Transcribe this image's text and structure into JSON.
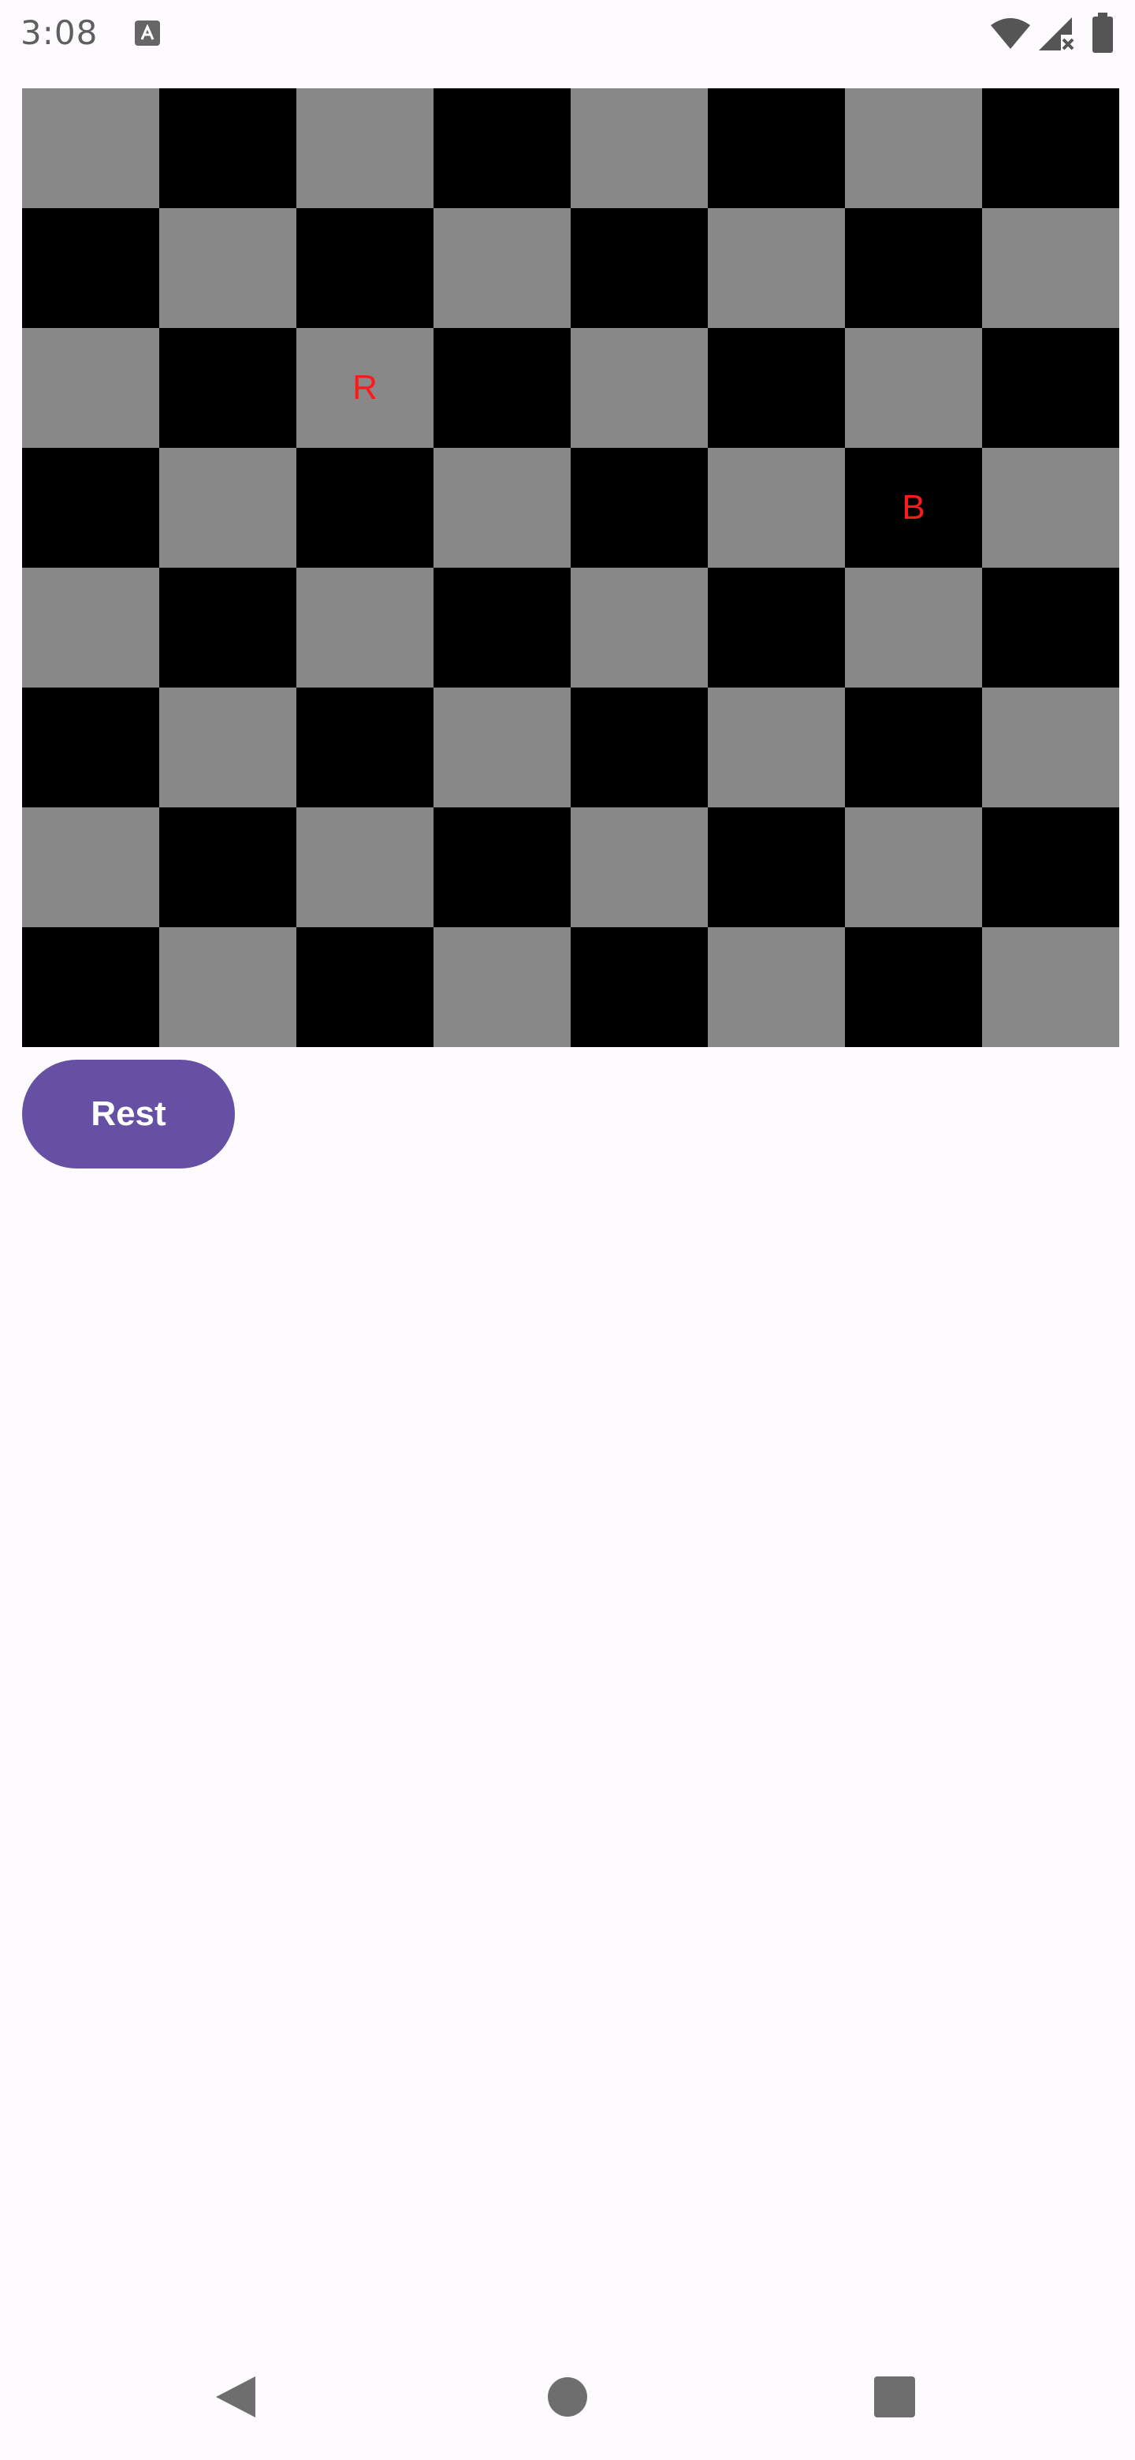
{
  "status_bar": {
    "time": "3:08",
    "notification_icon": "keyboard-a-icon",
    "wifi_icon": "wifi-icon",
    "signal_icon": "cell-signal-no-data-icon",
    "battery_icon": "battery-icon"
  },
  "board": {
    "rows": 8,
    "cols": 8,
    "light_color": "#888888",
    "dark_color": "#000000",
    "piece_color": "#ff1a1a",
    "pieces": [
      {
        "label": "R",
        "row": 2,
        "col": 2
      },
      {
        "label": "B",
        "row": 3,
        "col": 6
      }
    ]
  },
  "controls": {
    "rest_label": "Rest",
    "button_color": "#6650a4"
  },
  "nav_bar": {
    "back_icon": "back-triangle-icon",
    "home_icon": "home-circle-icon",
    "recents_icon": "recents-square-icon"
  }
}
